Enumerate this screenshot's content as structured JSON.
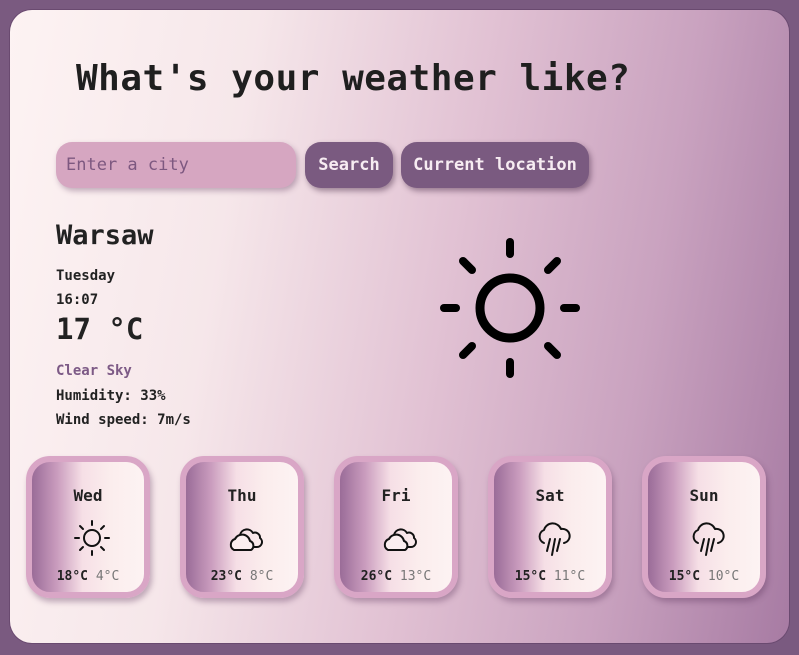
{
  "header": {
    "title": "What's your weather like?"
  },
  "search": {
    "placeholder": "Enter a city",
    "value": "",
    "search_label": "Search",
    "location_label": "Current location"
  },
  "current": {
    "city": "Warsaw",
    "day": "Tuesday",
    "time": "16:07",
    "temperature": "17 °C",
    "description": "Clear Sky",
    "humidity": "Humidity: 33%",
    "wind": "Wind speed: 7m/s",
    "icon": "sun-icon"
  },
  "forecast": [
    {
      "day": "Wed",
      "max": "18°C",
      "min": "4°C",
      "icon": "sun-icon"
    },
    {
      "day": "Thu",
      "max": "23°C",
      "min": "8°C",
      "icon": "clouds-icon"
    },
    {
      "day": "Fri",
      "max": "26°C",
      "min": "13°C",
      "icon": "clouds-icon"
    },
    {
      "day": "Sat",
      "max": "15°C",
      "min": "11°C",
      "icon": "rain-icon"
    },
    {
      "day": "Sun",
      "max": "15°C",
      "min": "10°C",
      "icon": "rain-icon"
    }
  ],
  "colors": {
    "accent": "#7a5a80",
    "input": "#d6a6c1",
    "description": "#7d5a86"
  }
}
